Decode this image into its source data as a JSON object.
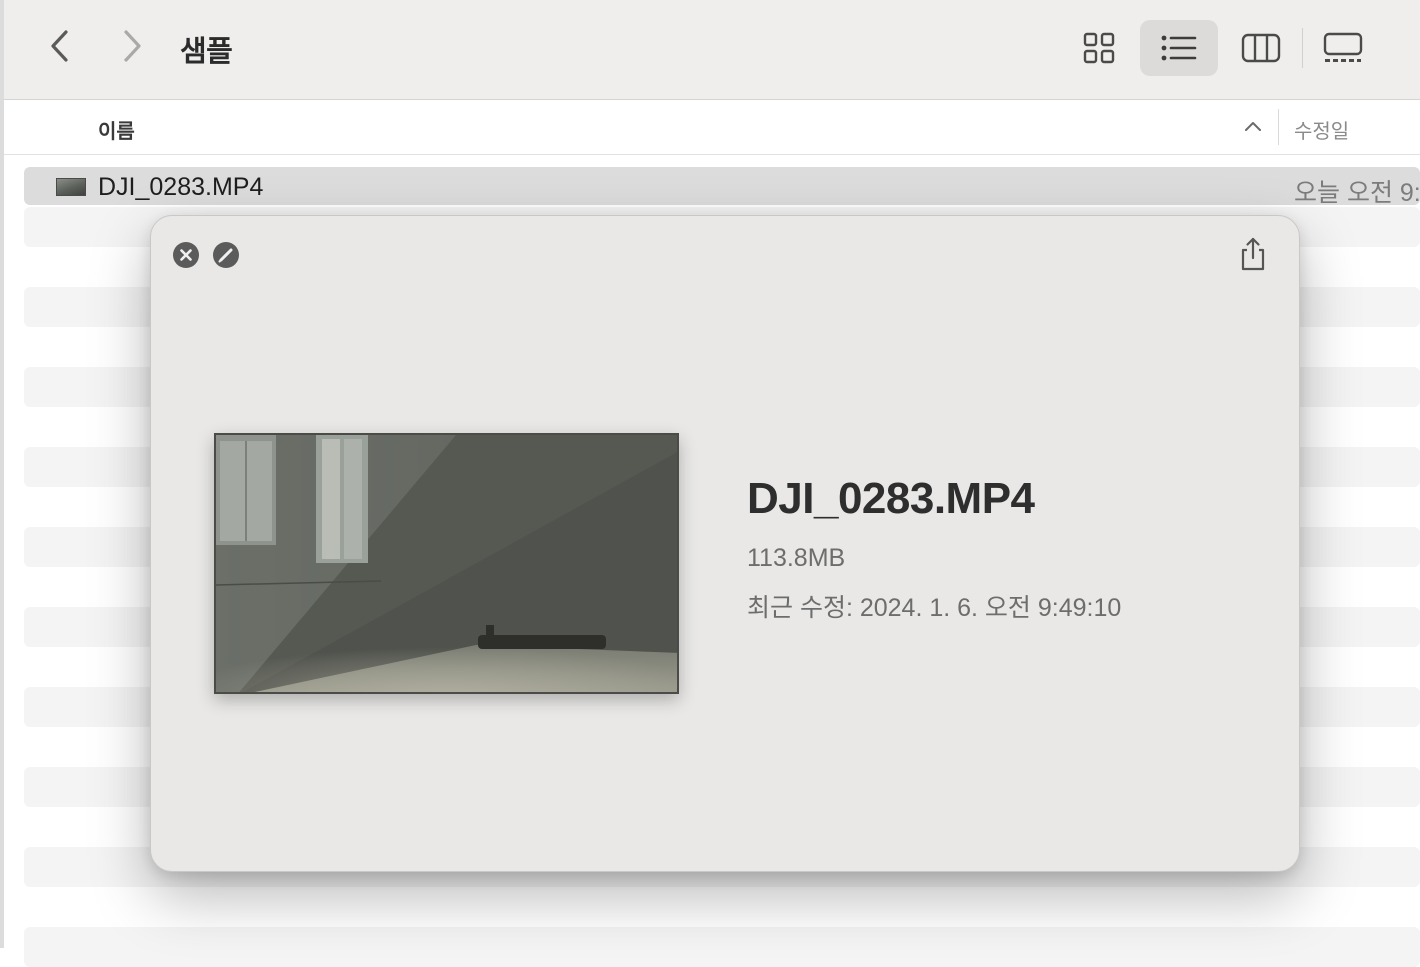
{
  "toolbar": {
    "folder_title": "샘플"
  },
  "columns": {
    "name": "이름",
    "date_modified": "수정일"
  },
  "files": [
    {
      "name": "DJI_0283.MP4",
      "date": "오늘 오전 9:"
    }
  ],
  "quicklook": {
    "file_name": "DJI_0283.MP4",
    "size": "113.8MB",
    "modified": "최근 수정: 2024. 1. 6. 오전 9:49:10"
  },
  "icons": {
    "back": "chevron-left-icon",
    "forward": "chevron-right-icon",
    "icon_view": "grid-icon",
    "list_view": "list-icon",
    "column_view": "columns-icon",
    "gallery_view": "gallery-icon",
    "sort": "chevron-up-icon",
    "close": "close-icon",
    "markup": "markup-icon",
    "share": "share-icon"
  },
  "colors": {
    "toolbar_bg": "#efeeed",
    "selected_row": "#dcdcdc",
    "quicklook_bg": "#e9e8e6",
    "active_view_bg": "#dcdbda"
  }
}
